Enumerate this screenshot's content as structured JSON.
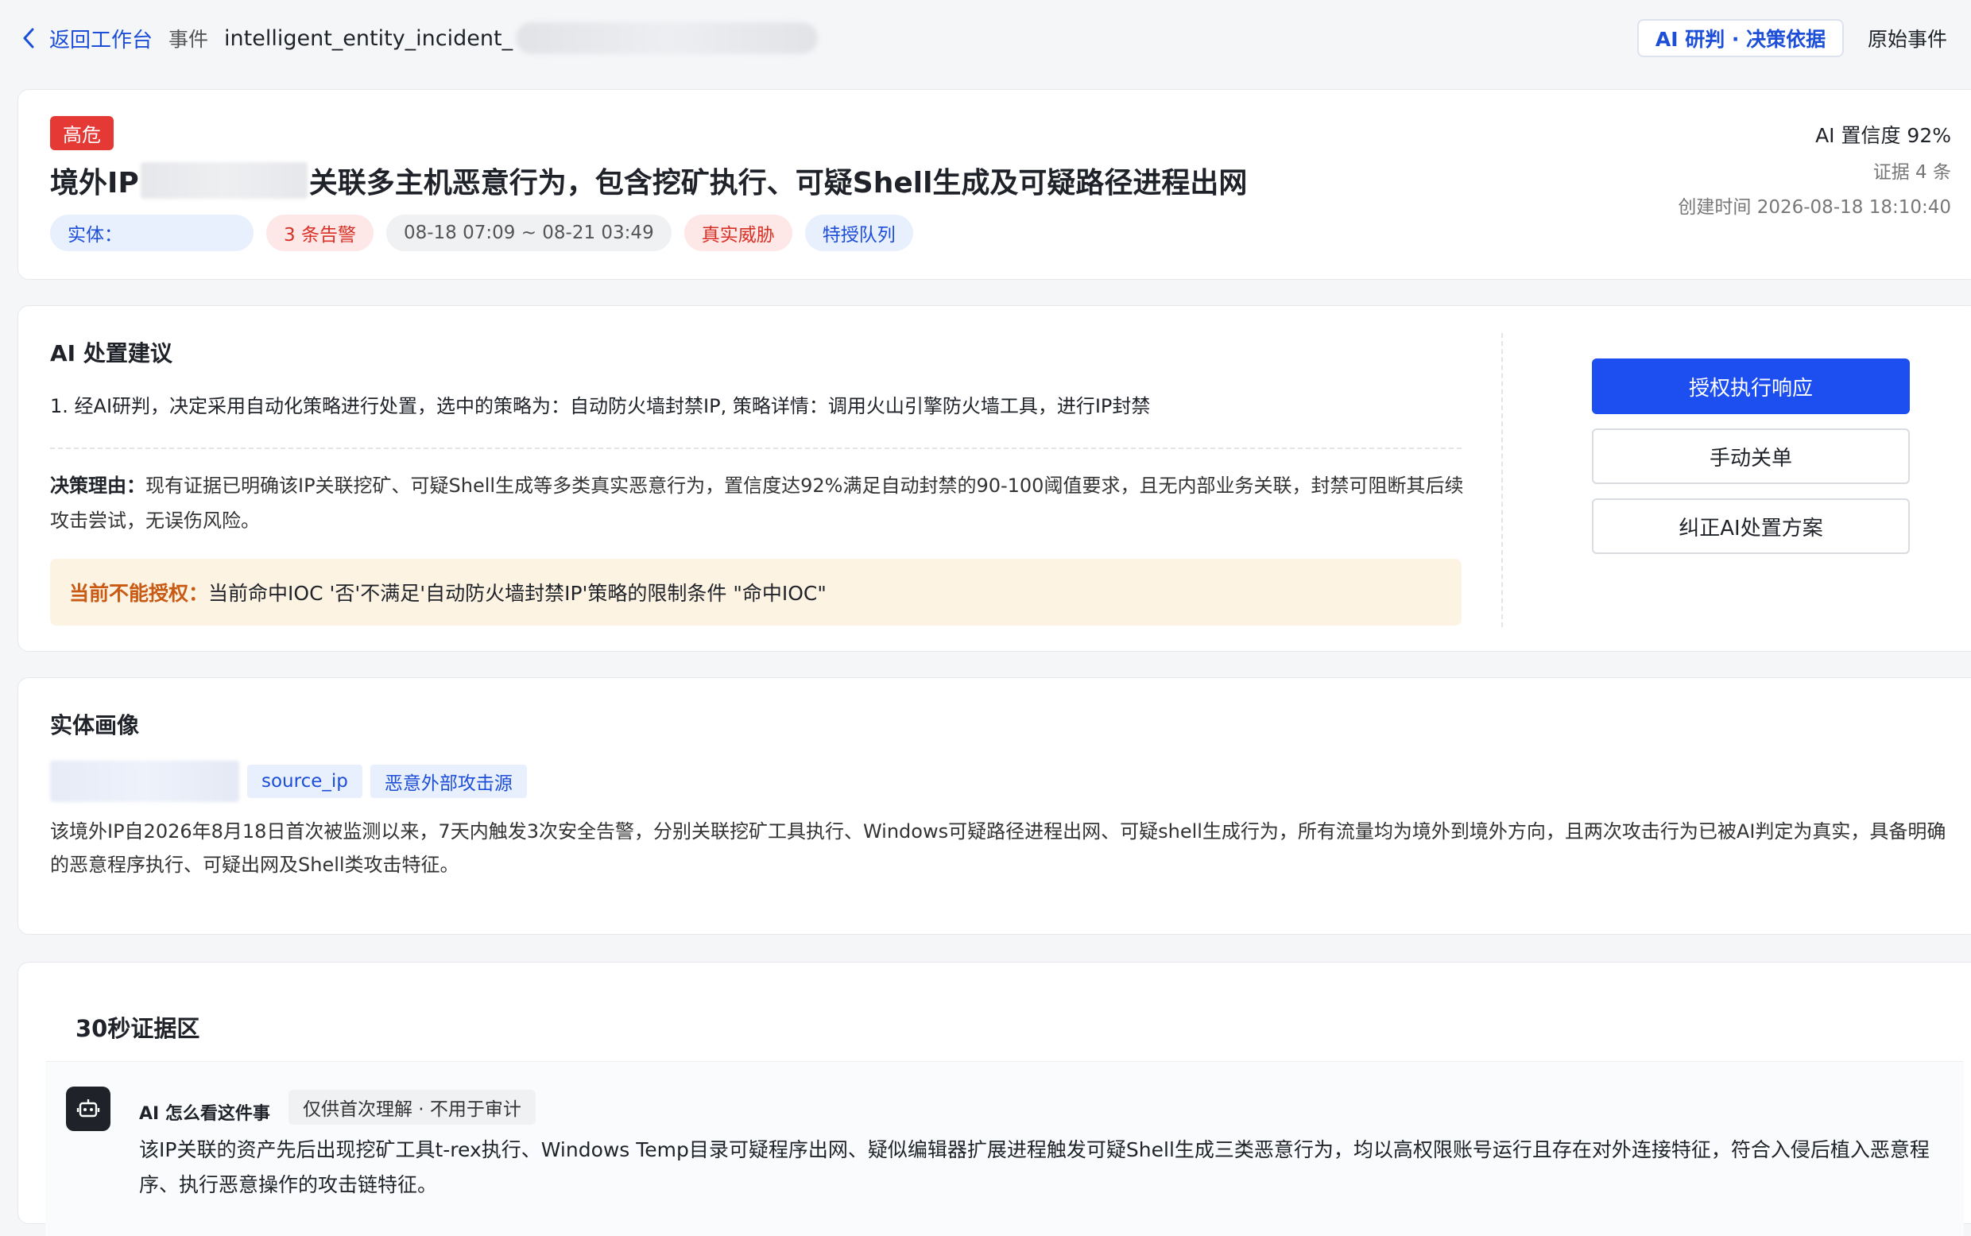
{
  "topbar": {
    "back_label": "返回工作台",
    "crumb_label": "事件",
    "incident_id": "intelligent_entity_incident_",
    "tabs": [
      {
        "label": "AI 研判 · 决策依据",
        "active": true
      },
      {
        "label": "原始事件",
        "active": false
      }
    ]
  },
  "header": {
    "severity": "高危",
    "title_prefix": "境外IP",
    "title_suffix": "关联多主机恶意行为，包含挖矿执行、可疑Shell生成及可疑路径进程出网",
    "chips": {
      "entity": "实体：",
      "alerts": "3 条告警",
      "time_range": "08-18 07:09 ~ 08-21 03:49",
      "verdict": "真实威胁",
      "queue": "特授队列"
    },
    "ai_confidence": "AI 置信度 92%",
    "evidence_count": "证据 4 条",
    "created_at": "创建时间 2026-08-18 18:10:40"
  },
  "recommendation": {
    "title": "AI 处置建议",
    "item": "1.  经AI研判，决定采用自动化策略进行处置，选中的策略为：自动防火墙封禁IP, 策略详情：调用火山引擎防火墙工具，进行IP封禁",
    "reason_label": "决策理由：",
    "reason_text": "现有证据已明确该IP关联挖矿、可疑Shell生成等多类真实恶意行为，置信度达92%满足自动封禁的90-100阈值要求，且无内部业务关联，封禁可阻断其后续攻击尝试，无误伤风险。",
    "warning_label": "当前不能授权：",
    "warning_text": "当前命中IOC '否'不满足'自动防火墙封禁IP'策略的限制条件 \"命中IOC\"",
    "buttons": {
      "authorize": "授权执行响应",
      "manual_close": "手动关单",
      "correct": "纠正AI处置方案"
    }
  },
  "portrait": {
    "title": "实体画像",
    "tags": [
      "source_ip",
      "恶意外部攻击源"
    ],
    "description": "该境外IP自2026年8月18日首次被监测以来，7天内触发3次安全告警，分别关联挖矿工具执行、Windows可疑路径进程出网、可疑shell生成行为，所有流量均为境外到境外方向，且两次攻击行为已被AI判定为真实，具备明确的恶意程序执行、可疑出网及Shell类攻击特征。"
  },
  "evidence": {
    "title": "30秒证据区",
    "ai_label": "AI 怎么看这件事",
    "ai_tag": "仅供首次理解 · 不用于审计",
    "ai_text": "该IP关联的资产先后出现挖矿工具t-rex执行、Windows Temp目录可疑程序出网、疑似编辑器扩展进程触发可疑Shell生成三类恶意行为，均以高权限账号运行且存在对外连接特征，符合入侵后植入恶意程序、执行恶意操作的攻击链特征。"
  },
  "colors": {
    "primary": "#1d4ef0",
    "danger": "#e53935",
    "warning_bg": "#fdf3e3",
    "warning_text": "#c85a14"
  }
}
